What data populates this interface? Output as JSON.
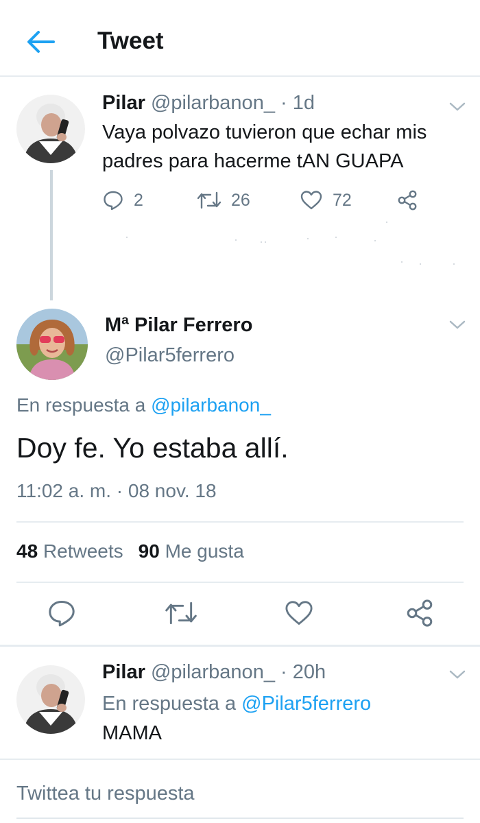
{
  "header": {
    "title": "Tweet"
  },
  "original_tweet": {
    "name": "Pilar",
    "handle": "@pilarbanon_",
    "time_sep": " · ",
    "age": "1d",
    "text": "Vaya polvazo tuvieron que echar mis padres para hacerme tAN GUAPA",
    "replies": "2",
    "retweets": "26",
    "likes": "72"
  },
  "main_tweet": {
    "name": "Mª Pilar Ferrero",
    "handle": "@Pilar5ferrero",
    "reply_prefix": "En respuesta a",
    "reply_to": "@pilarbanon_",
    "text": "Doy fe. Yo estaba allí.",
    "timestamp": "11:02 a. m. · 08 nov. 18",
    "retweet_count": "48",
    "retweet_label": "Retweets",
    "like_count": "90",
    "like_label": "Me gusta"
  },
  "reply_tweet": {
    "name": "Pilar",
    "handle": "@pilarbanon_",
    "time_sep": " · ",
    "age": "20h",
    "reply_prefix": "En respuesta a",
    "reply_to": "@Pilar5ferrero",
    "text": "MAMA"
  },
  "composer": {
    "placeholder": "Twittea tu respuesta"
  },
  "icons": {
    "back": "arrow-left-icon",
    "reply": "reply-icon",
    "retweet": "retweet-icon",
    "like": "heart-icon",
    "share": "share-icon",
    "menu": "chevron-down-icon"
  },
  "colors": {
    "accent": "#1da1f2",
    "text": "#14171a",
    "secondary": "#657786",
    "divider": "#e6ecf0"
  }
}
